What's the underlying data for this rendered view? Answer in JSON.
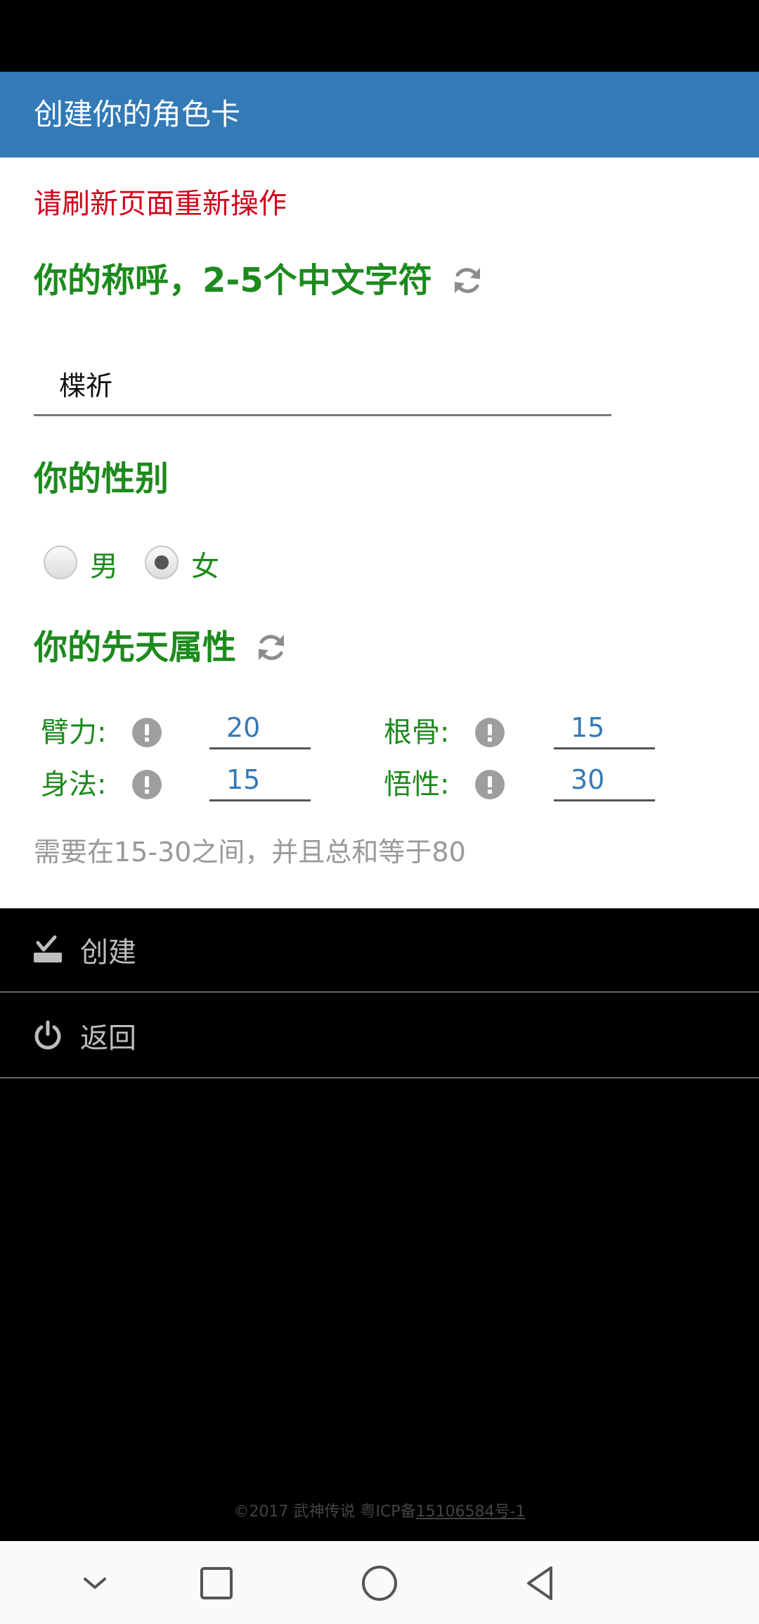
{
  "header": {
    "title": "创建你的角色卡"
  },
  "error_message": "请刷新页面重新操作",
  "name_section": {
    "title": "你的称呼，2-5个中文字符",
    "value": "楪祈"
  },
  "gender_section": {
    "title": "你的性别",
    "options": [
      {
        "label": "男",
        "selected": false
      },
      {
        "label": "女",
        "selected": true
      }
    ]
  },
  "attributes_section": {
    "title": "你的先天属性",
    "items": [
      {
        "label": "臂力:",
        "value": "20"
      },
      {
        "label": "根骨:",
        "value": "15"
      },
      {
        "label": "身法:",
        "value": "15"
      },
      {
        "label": "悟性:",
        "value": "30"
      }
    ],
    "hint": "需要在15-30之间，并且总和等于80"
  },
  "menu": {
    "create_label": "创建",
    "back_label": "返回"
  },
  "footer": {
    "prefix": "©2017 武神传说 粤ICP备",
    "icp_number": "15106584号-1"
  },
  "colors": {
    "header_bg": "#337ab7",
    "title_green": "#1d8a1d",
    "error_red": "#d0021b",
    "input_value_blue": "#337ab7"
  },
  "icons": {
    "refresh": "refresh-icon",
    "info": "exclamation-circle-icon",
    "create": "check-tray-icon",
    "back": "power-icon",
    "nav": [
      "chevron-down-icon",
      "square-icon",
      "circle-icon",
      "triangle-back-icon"
    ]
  }
}
